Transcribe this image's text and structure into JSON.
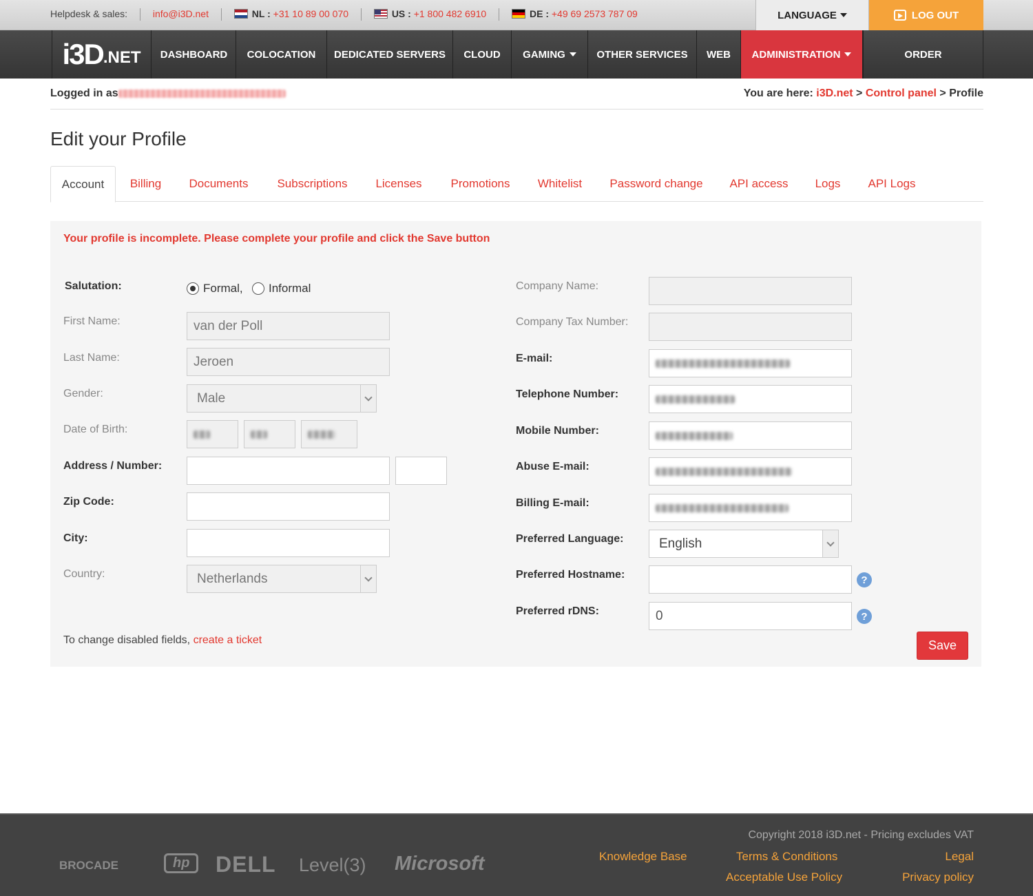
{
  "topbar": {
    "helpdesk_label": "Helpdesk & sales:",
    "email": "info@i3D.net",
    "nl_label": "NL :",
    "nl_phone": "+31 10 89 00 070",
    "us_label": "US :",
    "us_phone": "+1 800 482 6910",
    "de_label": "DE :",
    "de_phone": "+49 69 2573 787 09",
    "language_label": "LANGUAGE",
    "logout_label": "LOG OUT"
  },
  "logo": {
    "big": "i3D",
    "small": ".NET"
  },
  "nav": {
    "dashboard": "DASHBOARD",
    "colocation": "COLOCATION",
    "dedicated": "DEDICATED SERVERS",
    "cloud": "CLOUD",
    "gaming": "GAMING",
    "other": "OTHER SERVICES",
    "web": "WEB",
    "administration": "ADMINISTRATION",
    "order": "ORDER",
    "active_color": "#d9363e"
  },
  "subhead": {
    "logged_in_label": "Logged in as",
    "you_are_here": "You are here:",
    "crumb_1": "i3D.net",
    "crumb_2": "Control panel",
    "crumb_3": "Profile",
    "sep": ">"
  },
  "page_title": "Edit your Profile",
  "tabs": {
    "account": "Account",
    "billing": "Billing",
    "documents": "Documents",
    "subscriptions": "Subscriptions",
    "licenses": "Licenses",
    "promotions": "Promotions",
    "whitelist": "Whitelist",
    "password": "Password change",
    "api_access": "API access",
    "logs": "Logs",
    "api_logs": "API Logs"
  },
  "form": {
    "notice": "Your profile is incomplete. Please complete your profile and click the Save button",
    "salutation_label": "Salutation:",
    "formal": "Formal,",
    "informal": "Informal",
    "first_name_label": "First Name:",
    "first_name_value": "van der Poll",
    "last_name_label": "Last Name:",
    "last_name_value": "Jeroen",
    "gender_label": "Gender:",
    "gender_value": "Male",
    "dob_label": "Date of Birth:",
    "address_label": "Address / Number:",
    "zip_label": "Zip Code:",
    "city_label": "City:",
    "country_label": "Country:",
    "country_value": "Netherlands",
    "company_name_label": "Company Name:",
    "company_tax_label": "Company Tax Number:",
    "email_label": "E-mail:",
    "telephone_label": "Telephone Number:",
    "mobile_label": "Mobile Number:",
    "abuse_email_label": "Abuse E-mail:",
    "billing_email_label": "Billing E-mail:",
    "pref_lang_label": "Preferred Language:",
    "pref_lang_value": "English",
    "pref_host_label": "Preferred Hostname:",
    "pref_rdns_label": "Preferred rDNS:",
    "pref_rdns_value": "0",
    "help_glyph": "?",
    "change_note": "To change disabled fields,",
    "create_ticket": "create a ticket",
    "save_label": "Save"
  },
  "footer": {
    "partners": [
      "BROCADE",
      "hp",
      "DELL",
      "Level(3)",
      "Microsoft"
    ],
    "copyright": "Copyright 2018 i3D.net - Pricing excludes VAT",
    "knowledge_base": "Knowledge Base",
    "terms": "Terms & Conditions",
    "legal": "Legal",
    "aup": "Acceptable Use Policy",
    "privacy": "Privacy policy"
  }
}
